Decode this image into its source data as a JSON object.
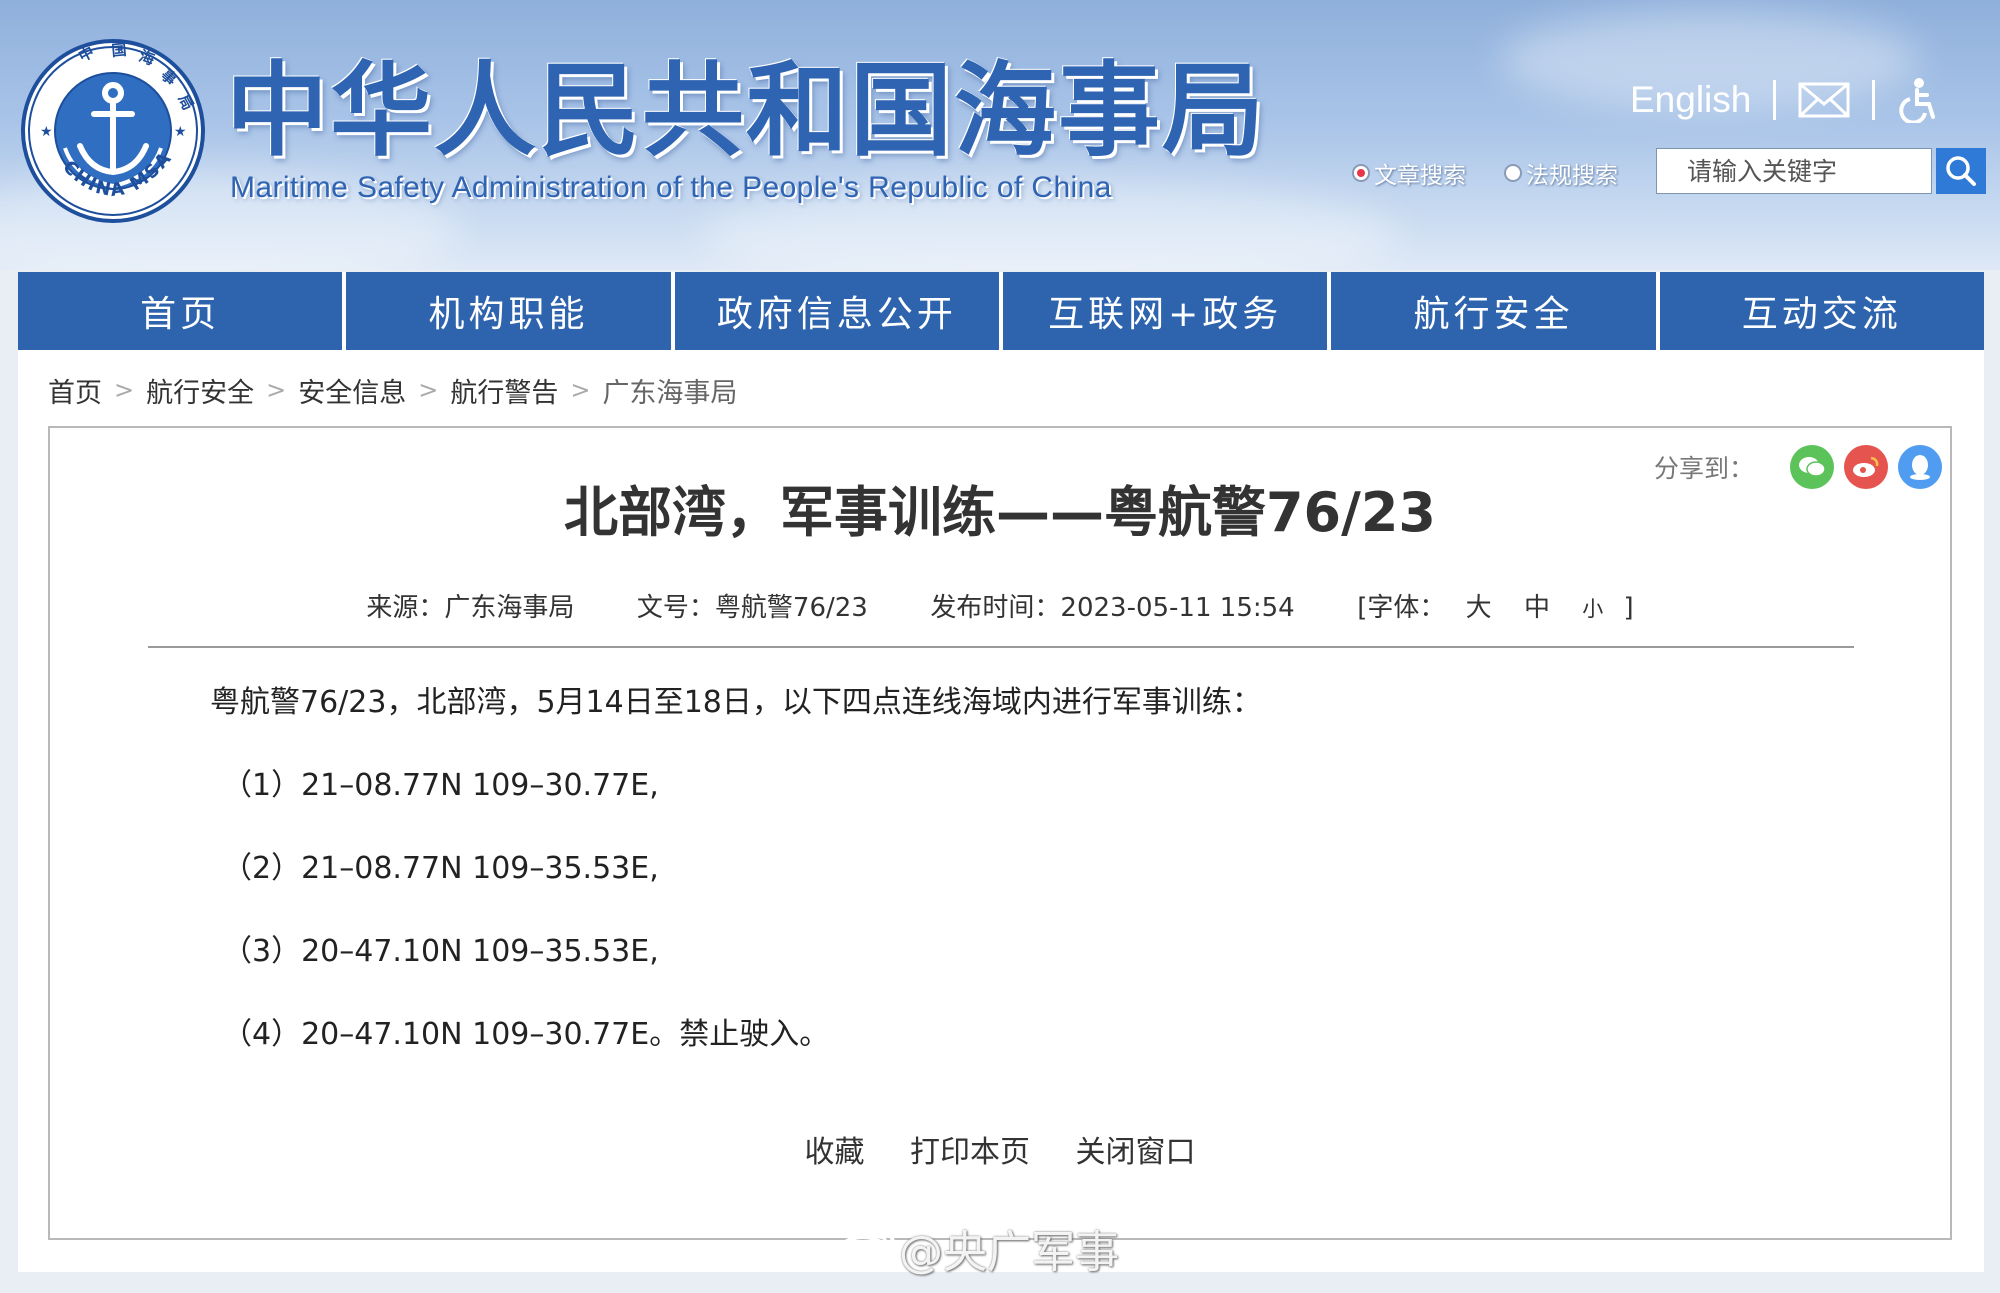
{
  "header": {
    "title_cn": "中华人民共和国海事局",
    "title_en": "Maritime Safety Administration of the People's Republic of China",
    "logo": {
      "top_text": "中 国 海 事 局",
      "bottom_text": "CHINA MSA",
      "icon": "anchor-icon"
    },
    "links": {
      "english": "English",
      "mail_icon": "mail-icon",
      "access_icon": "accessibility-icon"
    },
    "search": {
      "option_article": "文章搜索",
      "option_law": "法规搜索",
      "placeholder": "请输入关键字",
      "search_icon": "search-icon"
    }
  },
  "nav": [
    {
      "label": "首页"
    },
    {
      "label": "机构职能"
    },
    {
      "label": "政府信息公开"
    },
    {
      "label": "互联网+政务"
    },
    {
      "label": "航行安全"
    },
    {
      "label": "互动交流"
    }
  ],
  "breadcrumb": [
    "首页",
    "航行安全",
    "安全信息",
    "航行警告",
    "广东海事局"
  ],
  "breadcrumb_sep": ">",
  "share": {
    "label": "分享到：",
    "icons": [
      "wechat-icon",
      "weibo-icon",
      "qq-icon"
    ]
  },
  "article": {
    "title": "北部湾，军事训练——粤航警76/23",
    "meta": {
      "source_label": "来源：",
      "source": "广东海事局",
      "number_label": "文号：",
      "number": "粤航警76/23",
      "time_label": "发布时间：",
      "time": "2023-05-11 15:54",
      "font_label": "[字体：",
      "font_large": "大",
      "font_medium": "中",
      "font_small": "小",
      "font_close": "]"
    },
    "paragraphs": [
      "粤航警76/23，北部湾，5月14日至18日，以下四点连线海域内进行军事训练：",
      "（1）21–08.77N 109–30.77E,",
      "（2）21–08.77N 109–35.53E,",
      "（3）20–47.10N 109–35.53E,",
      "（4）20–47.10N 109–30.77E。禁止驶入。"
    ]
  },
  "actions": {
    "favorite": "收藏",
    "print": "打印本页",
    "close": "关闭窗口"
  },
  "watermark": "@央广军事",
  "colors": {
    "brand_blue": "#2e63ae",
    "title_blue": "#2f64b3",
    "search_blue": "#2f7ad6"
  }
}
